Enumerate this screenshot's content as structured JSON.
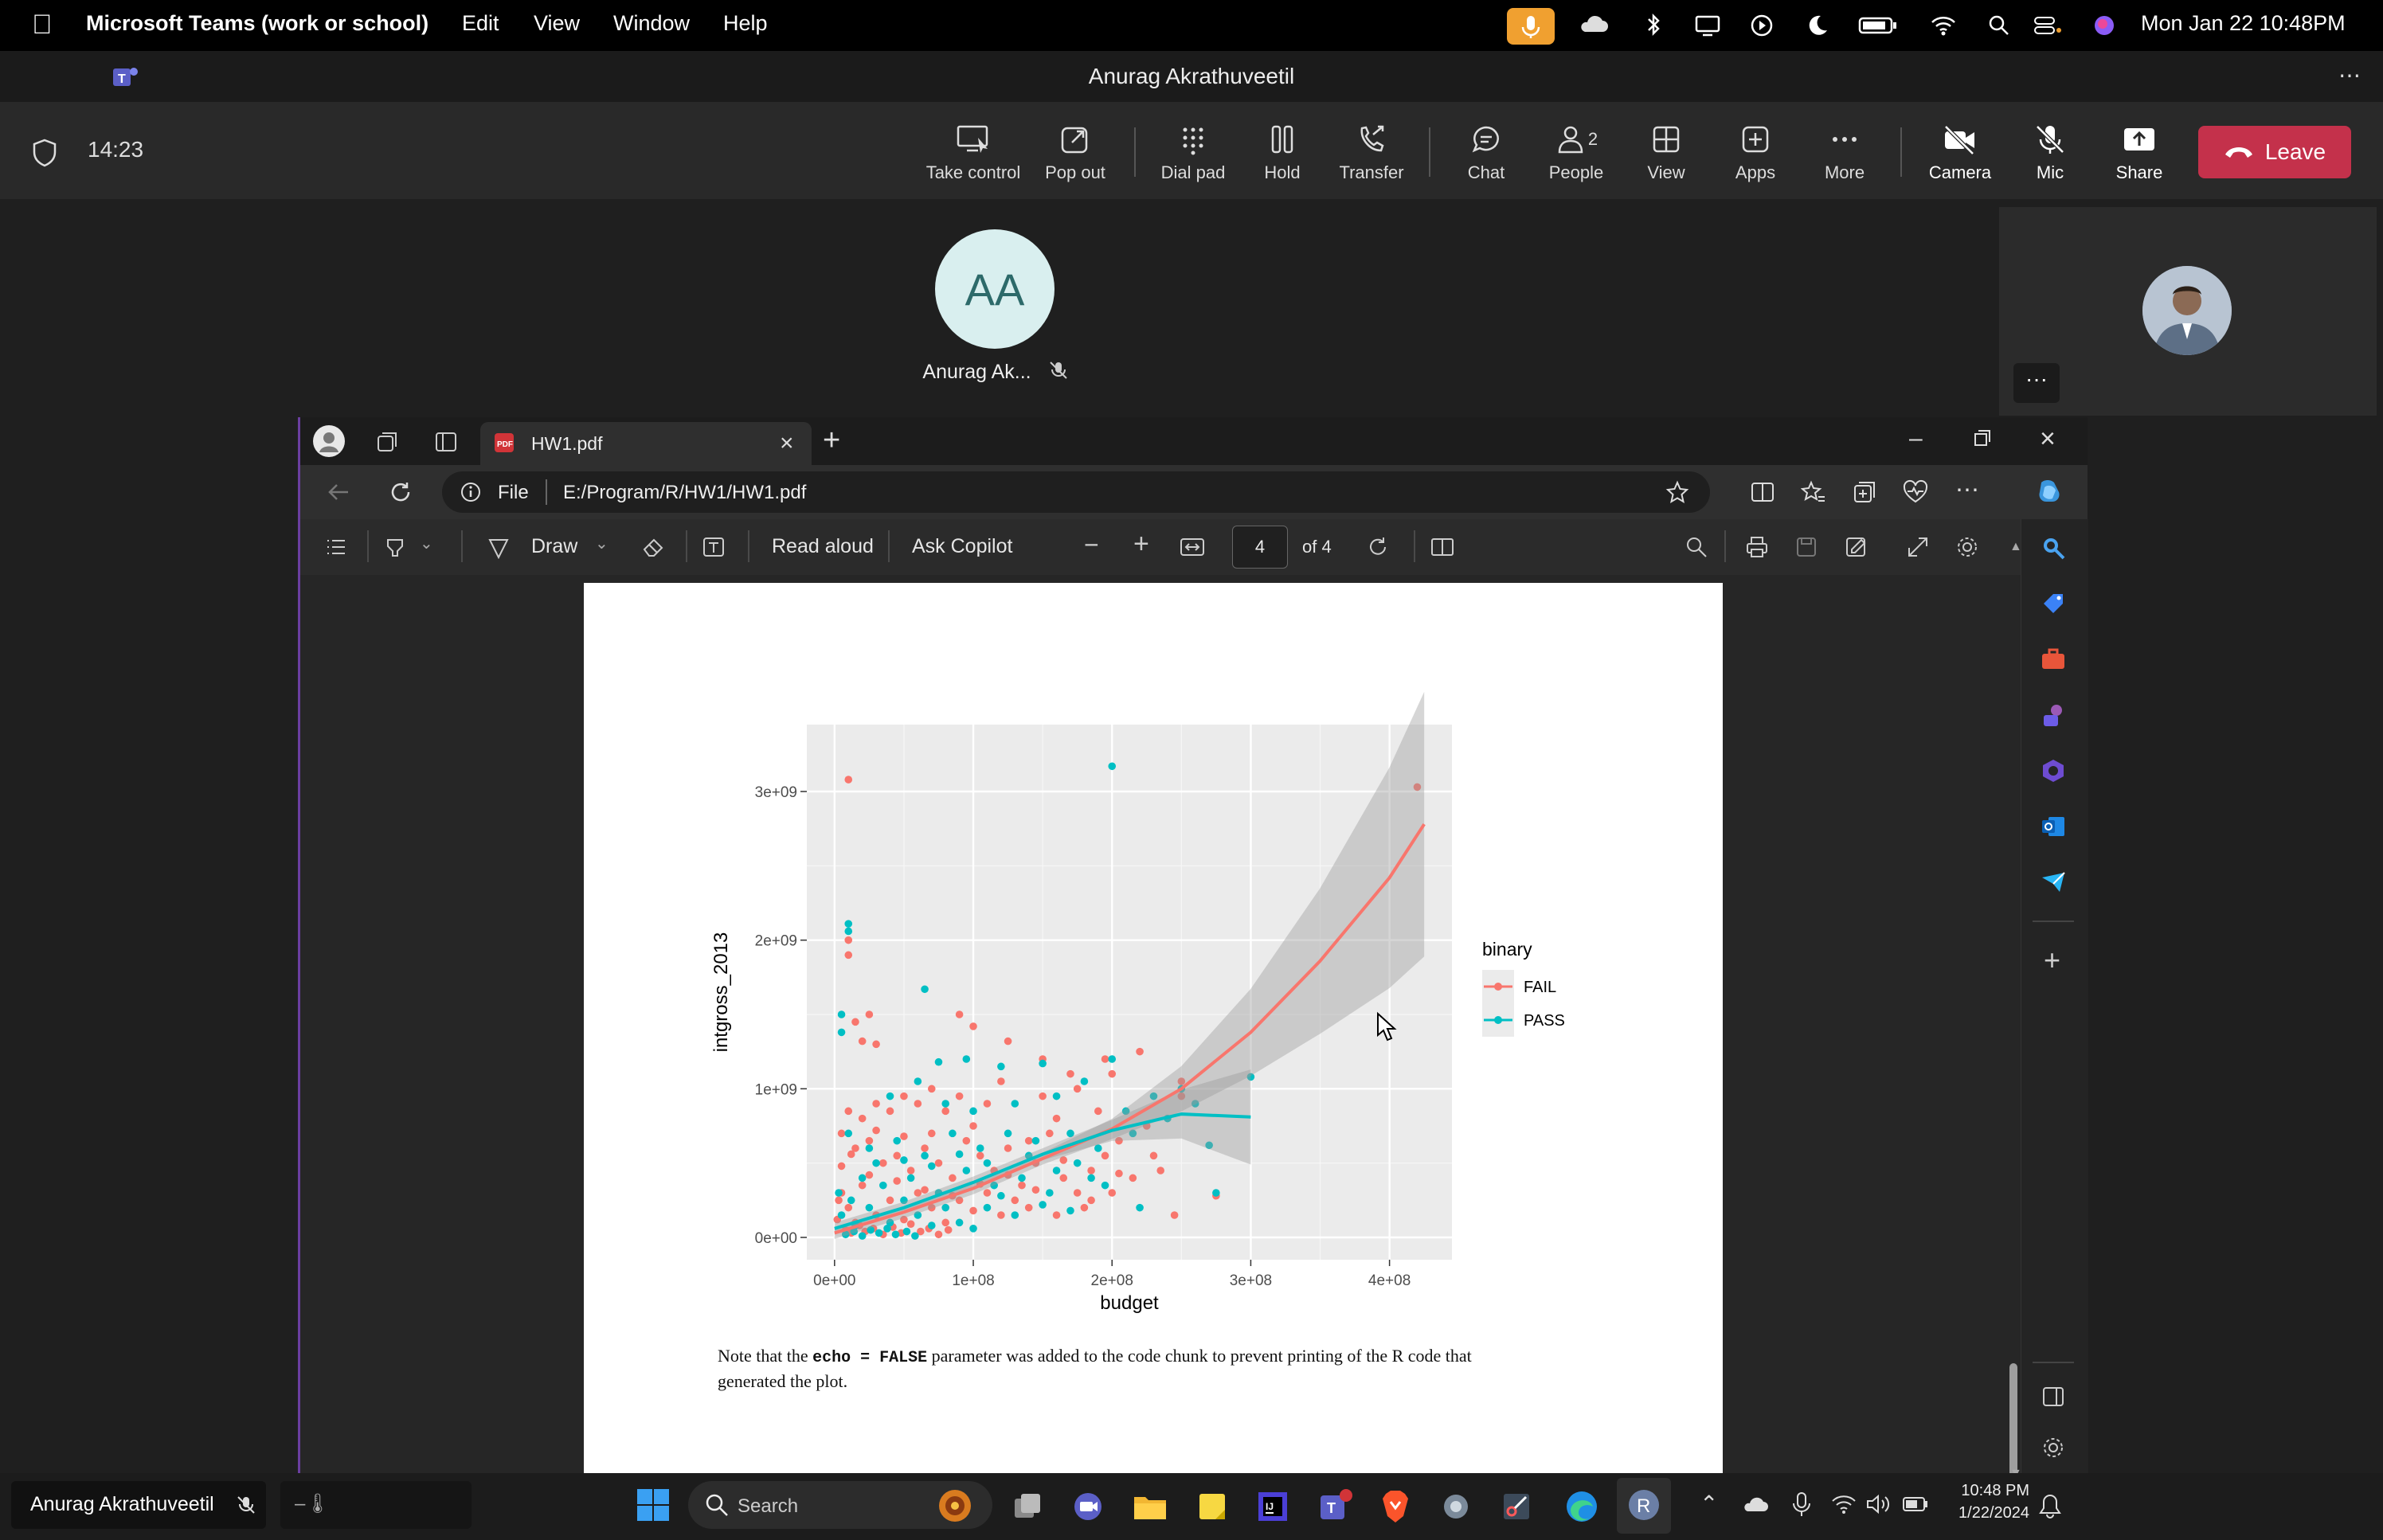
{
  "menubar": {
    "app_name": "Microsoft Teams (work or school)",
    "items": [
      "Edit",
      "View",
      "Window",
      "Help"
    ],
    "datetime": "Mon Jan 22  10:48PM"
  },
  "teams": {
    "window_title": "Anurag Akrathuveetil",
    "timer": "14:23",
    "toolbar": [
      {
        "label": "Take control",
        "icon": "take-control-icon"
      },
      {
        "label": "Pop out",
        "icon": "pop-out-icon"
      },
      {
        "label": "Dial pad",
        "icon": "dial-pad-icon"
      },
      {
        "label": "Hold",
        "icon": "hold-icon"
      },
      {
        "label": "Transfer",
        "icon": "transfer-icon"
      },
      {
        "label": "Chat",
        "icon": "chat-icon"
      },
      {
        "label": "People",
        "icon": "people-icon",
        "count": "2"
      },
      {
        "label": "View",
        "icon": "view-icon"
      },
      {
        "label": "Apps",
        "icon": "apps-icon"
      },
      {
        "label": "More",
        "icon": "more-icon"
      },
      {
        "label": "Camera",
        "icon": "camera-off-icon"
      },
      {
        "label": "Mic",
        "icon": "mic-off-icon"
      },
      {
        "label": "Share",
        "icon": "share-icon"
      }
    ],
    "leave_label": "Leave",
    "participant_initials": "AA",
    "participant_name": "Anurag Ak...",
    "tile_more": "···",
    "leave_color": "#c4314b"
  },
  "edge": {
    "tab_title": "HW1.pdf",
    "address_prefix": "File",
    "address": "E:/Program/R/HW1/HW1.pdf",
    "pdf_toolbar": {
      "draw_label": "Draw",
      "read_aloud_label": "Read aloud",
      "ask_copilot_label": "Ask Copilot",
      "page_number": "4",
      "page_total": "of 4"
    }
  },
  "pdf_page": {
    "note_prefix": "Note that the ",
    "note_code": "echo = FALSE",
    "note_suffix": " parameter was added to the code chunk to prevent printing of the R code that",
    "note_line2": "generated the plot."
  },
  "chart_data": {
    "type": "scatter",
    "xlabel": "budget",
    "ylabel": "intgross_2013",
    "x_ticks": [
      "0e+00",
      "1e+08",
      "2e+08",
      "3e+08",
      "4e+08"
    ],
    "y_ticks": [
      "0e+00",
      "1e+09",
      "2e+09",
      "3e+09"
    ],
    "xlim": [
      -20000000,
      445000000
    ],
    "ylim": [
      -150000000,
      3450000000
    ],
    "legend_title": "binary",
    "legend_position": "right",
    "grid": true,
    "background": "#ebebeb",
    "series": [
      {
        "name": "FAIL",
        "color": "#f8766d",
        "points": [
          [
            10000000,
            3080000000
          ],
          [
            10000000,
            1900000000
          ],
          [
            10000000,
            2000000000
          ],
          [
            25000000,
            1500000000
          ],
          [
            15000000,
            1450000000
          ],
          [
            20000000,
            1320000000
          ],
          [
            30000000,
            1300000000
          ],
          [
            90000000,
            1500000000
          ],
          [
            100000000,
            1420000000
          ],
          [
            125000000,
            1320000000
          ],
          [
            150000000,
            1200000000
          ],
          [
            170000000,
            1100000000
          ],
          [
            195000000,
            1200000000
          ],
          [
            220000000,
            1250000000
          ],
          [
            250000000,
            1050000000
          ],
          [
            250000000,
            950000000
          ],
          [
            200000000,
            1100000000
          ],
          [
            175000000,
            1000000000
          ],
          [
            150000000,
            950000000
          ],
          [
            120000000,
            1050000000
          ],
          [
            110000000,
            900000000
          ],
          [
            90000000,
            950000000
          ],
          [
            80000000,
            850000000
          ],
          [
            70000000,
            1000000000
          ],
          [
            60000000,
            900000000
          ],
          [
            50000000,
            950000000
          ],
          [
            40000000,
            850000000
          ],
          [
            30000000,
            900000000
          ],
          [
            20000000,
            800000000
          ],
          [
            10000000,
            850000000
          ],
          [
            5000000,
            700000000
          ],
          [
            15000000,
            600000000
          ],
          [
            25000000,
            650000000
          ],
          [
            35000000,
            500000000
          ],
          [
            45000000,
            550000000
          ],
          [
            55000000,
            450000000
          ],
          [
            65000000,
            600000000
          ],
          [
            75000000,
            500000000
          ],
          [
            85000000,
            400000000
          ],
          [
            95000000,
            650000000
          ],
          [
            105000000,
            550000000
          ],
          [
            115000000,
            450000000
          ],
          [
            125000000,
            600000000
          ],
          [
            135000000,
            350000000
          ],
          [
            145000000,
            500000000
          ],
          [
            155000000,
            700000000
          ],
          [
            165000000,
            400000000
          ],
          [
            175000000,
            300000000
          ],
          [
            185000000,
            450000000
          ],
          [
            195000000,
            550000000
          ],
          [
            205000000,
            650000000
          ],
          [
            215000000,
            400000000
          ],
          [
            225000000,
            750000000
          ],
          [
            235000000,
            450000000
          ],
          [
            245000000,
            150000000
          ],
          [
            275000000,
            280000000
          ],
          [
            420000000,
            3030000000
          ],
          [
            5000000,
            300000000
          ],
          [
            10000000,
            200000000
          ],
          [
            15000000,
            100000000
          ],
          [
            20000000,
            350000000
          ],
          [
            30000000,
            150000000
          ],
          [
            40000000,
            250000000
          ],
          [
            50000000,
            120000000
          ],
          [
            60000000,
            300000000
          ],
          [
            70000000,
            200000000
          ],
          [
            80000000,
            100000000
          ],
          [
            90000000,
            250000000
          ],
          [
            100000000,
            180000000
          ],
          [
            110000000,
            300000000
          ],
          [
            120000000,
            150000000
          ],
          [
            130000000,
            250000000
          ],
          [
            140000000,
            200000000
          ],
          [
            160000000,
            150000000
          ],
          [
            180000000,
            200000000
          ],
          [
            200000000,
            300000000
          ],
          [
            8000000,
            50000000
          ],
          [
            12000000,
            30000000
          ],
          [
            18000000,
            80000000
          ],
          [
            22000000,
            40000000
          ],
          [
            28000000,
            60000000
          ],
          [
            35000000,
            20000000
          ],
          [
            42000000,
            70000000
          ],
          [
            48000000,
            30000000
          ],
          [
            55000000,
            90000000
          ],
          [
            62000000,
            40000000
          ],
          [
            68000000,
            60000000
          ],
          [
            75000000,
            20000000
          ],
          [
            82000000,
            50000000
          ],
          [
            5000000,
            480000000
          ],
          [
            25000000,
            420000000
          ],
          [
            45000000,
            380000000
          ],
          [
            65000000,
            320000000
          ],
          [
            85000000,
            280000000
          ],
          [
            105000000,
            360000000
          ],
          [
            125000000,
            420000000
          ],
          [
            145000000,
            320000000
          ],
          [
            165000000,
            520000000
          ],
          [
            185000000,
            250000000
          ],
          [
            205000000,
            430000000
          ],
          [
            230000000,
            550000000
          ],
          [
            190000000,
            850000000
          ],
          [
            160000000,
            800000000
          ],
          [
            140000000,
            650000000
          ],
          [
            100000000,
            750000000
          ],
          [
            70000000,
            700000000
          ],
          [
            50000000,
            680000000
          ],
          [
            30000000,
            720000000
          ],
          [
            12000000,
            560000000
          ],
          [
            2000000,
            120000000
          ],
          [
            3000000,
            250000000
          ]
        ]
      },
      {
        "name": "PASS",
        "color": "#00bfc4",
        "points": [
          [
            200000000,
            3170000000
          ],
          [
            10000000,
            2110000000
          ],
          [
            10000000,
            2060000000
          ],
          [
            65000000,
            1670000000
          ],
          [
            5000000,
            1500000000
          ],
          [
            5000000,
            1380000000
          ],
          [
            75000000,
            1180000000
          ],
          [
            95000000,
            1200000000
          ],
          [
            120000000,
            1150000000
          ],
          [
            150000000,
            1170000000
          ],
          [
            180000000,
            1050000000
          ],
          [
            200000000,
            1200000000
          ],
          [
            230000000,
            950000000
          ],
          [
            250000000,
            1000000000
          ],
          [
            300000000,
            1080000000
          ],
          [
            270000000,
            620000000
          ],
          [
            275000000,
            300000000
          ],
          [
            40000000,
            950000000
          ],
          [
            60000000,
            1050000000
          ],
          [
            80000000,
            900000000
          ],
          [
            100000000,
            850000000
          ],
          [
            130000000,
            900000000
          ],
          [
            160000000,
            950000000
          ],
          [
            210000000,
            850000000
          ],
          [
            10000000,
            700000000
          ],
          [
            25000000,
            600000000
          ],
          [
            45000000,
            650000000
          ],
          [
            65000000,
            550000000
          ],
          [
            85000000,
            700000000
          ],
          [
            105000000,
            600000000
          ],
          [
            125000000,
            700000000
          ],
          [
            145000000,
            650000000
          ],
          [
            170000000,
            700000000
          ],
          [
            190000000,
            600000000
          ],
          [
            215000000,
            700000000
          ],
          [
            20000000,
            400000000
          ],
          [
            35000000,
            350000000
          ],
          [
            55000000,
            400000000
          ],
          [
            75000000,
            300000000
          ],
          [
            95000000,
            450000000
          ],
          [
            115000000,
            350000000
          ],
          [
            135000000,
            400000000
          ],
          [
            155000000,
            300000000
          ],
          [
            175000000,
            500000000
          ],
          [
            195000000,
            350000000
          ],
          [
            220000000,
            200000000
          ],
          [
            5000000,
            150000000
          ],
          [
            15000000,
            80000000
          ],
          [
            25000000,
            200000000
          ],
          [
            40000000,
            100000000
          ],
          [
            50000000,
            250000000
          ],
          [
            60000000,
            150000000
          ],
          [
            70000000,
            80000000
          ],
          [
            80000000,
            200000000
          ],
          [
            90000000,
            100000000
          ],
          [
            100000000,
            60000000
          ],
          [
            110000000,
            200000000
          ],
          [
            120000000,
            280000000
          ],
          [
            130000000,
            150000000
          ],
          [
            150000000,
            220000000
          ],
          [
            170000000,
            180000000
          ],
          [
            8000000,
            20000000
          ],
          [
            14000000,
            40000000
          ],
          [
            20000000,
            10000000
          ],
          [
            26000000,
            50000000
          ],
          [
            32000000,
            30000000
          ],
          [
            38000000,
            60000000
          ],
          [
            44000000,
            20000000
          ],
          [
            52000000,
            40000000
          ],
          [
            58000000,
            10000000
          ],
          [
            3000000,
            300000000
          ],
          [
            12000000,
            250000000
          ],
          [
            30000000,
            500000000
          ],
          [
            50000000,
            520000000
          ],
          [
            70000000,
            480000000
          ],
          [
            90000000,
            560000000
          ],
          [
            110000000,
            500000000
          ],
          [
            140000000,
            550000000
          ],
          [
            160000000,
            450000000
          ],
          [
            185000000,
            400000000
          ],
          [
            240000000,
            800000000
          ],
          [
            260000000,
            900000000
          ]
        ]
      }
    ],
    "smooth": {
      "FAIL": {
        "x": [
          0,
          50000000,
          100000000,
          150000000,
          200000000,
          250000000,
          300000000,
          350000000,
          400000000,
          425000000
        ],
        "y": [
          30000000,
          170000000,
          330000000,
          530000000,
          730000000,
          1000000000,
          1380000000,
          1860000000,
          2420000000,
          2780000000
        ]
      },
      "PASS": {
        "x": [
          0,
          50000000,
          100000000,
          150000000,
          200000000,
          250000000,
          300000000
        ],
        "y": [
          60000000,
          200000000,
          370000000,
          560000000,
          720000000,
          830000000,
          810000000
        ]
      }
    }
  }
}
